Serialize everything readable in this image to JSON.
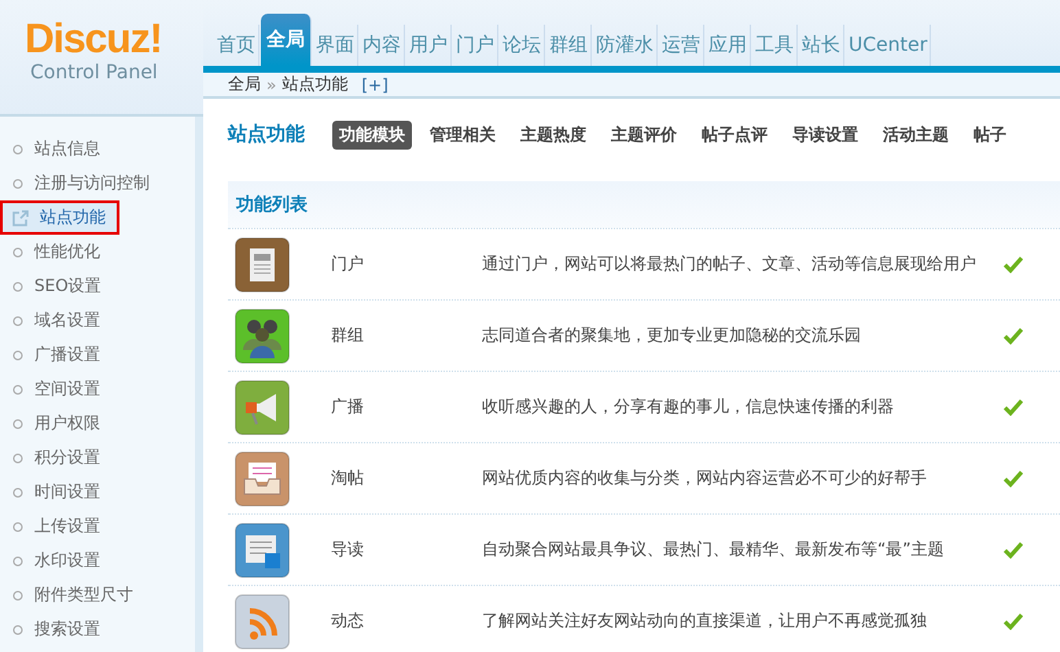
{
  "logo": {
    "title": "Discuz!",
    "subtitle": "Control Panel"
  },
  "nav": [
    {
      "label": "首页",
      "selected": false
    },
    {
      "label": "全局",
      "selected": true
    },
    {
      "label": "界面",
      "selected": false
    },
    {
      "label": "内容",
      "selected": false
    },
    {
      "label": "用户",
      "selected": false
    },
    {
      "label": "门户",
      "selected": false
    },
    {
      "label": "论坛",
      "selected": false
    },
    {
      "label": "群组",
      "selected": false
    },
    {
      "label": "防灌水",
      "selected": false
    },
    {
      "label": "运营",
      "selected": false
    },
    {
      "label": "应用",
      "selected": false
    },
    {
      "label": "工具",
      "selected": false
    },
    {
      "label": "站长",
      "selected": false
    },
    {
      "label": "UCenter",
      "selected": false
    }
  ],
  "breadcrumb": {
    "parent": "全局",
    "separator": "»",
    "current": "站点功能",
    "toggle": "[+]"
  },
  "sidebar": {
    "items": [
      {
        "label": "站点信息",
        "selected": false,
        "highlighted": false
      },
      {
        "label": "注册与访问控制",
        "selected": false,
        "highlighted": false
      },
      {
        "label": "站点功能",
        "selected": true,
        "highlighted": true
      },
      {
        "label": "性能优化",
        "selected": false,
        "highlighted": false
      },
      {
        "label": "SEO设置",
        "selected": false,
        "highlighted": false
      },
      {
        "label": "域名设置",
        "selected": false,
        "highlighted": false
      },
      {
        "label": "广播设置",
        "selected": false,
        "highlighted": false
      },
      {
        "label": "空间设置",
        "selected": false,
        "highlighted": false
      },
      {
        "label": "用户权限",
        "selected": false,
        "highlighted": false
      },
      {
        "label": "积分设置",
        "selected": false,
        "highlighted": false
      },
      {
        "label": "时间设置",
        "selected": false,
        "highlighted": false
      },
      {
        "label": "上传设置",
        "selected": false,
        "highlighted": false
      },
      {
        "label": "水印设置",
        "selected": false,
        "highlighted": false
      },
      {
        "label": "附件类型尺寸",
        "selected": false,
        "highlighted": false
      },
      {
        "label": "搜索设置",
        "selected": false,
        "highlighted": false
      }
    ]
  },
  "page_title": "站点功能",
  "subtabs": [
    {
      "label": "功能模块",
      "selected": true
    },
    {
      "label": "管理相关",
      "selected": false
    },
    {
      "label": "主题热度",
      "selected": false
    },
    {
      "label": "主题评价",
      "selected": false
    },
    {
      "label": "帖子点评",
      "selected": false
    },
    {
      "label": "导读设置",
      "selected": false
    },
    {
      "label": "活动主题",
      "selected": false
    },
    {
      "label": "帖子",
      "selected": false
    }
  ],
  "table": {
    "header": "功能列表",
    "rows": [
      {
        "kind": "newspaper",
        "name": "门户",
        "description": "通过门户，网站可以将最热门的帖子、文章、活动等信息展现给用户",
        "enabled": true
      },
      {
        "kind": "people",
        "name": "群组",
        "description": "志同道合者的聚集地，更加专业更加隐秘的交流乐园",
        "enabled": true
      },
      {
        "kind": "megaphone",
        "name": "广播",
        "description": "收听感兴趣的人，分享有趣的事儿，信息快速传播的利器",
        "enabled": true
      },
      {
        "kind": "tray",
        "name": "淘帖",
        "description": "网站优质内容的收集与分类，网站内容运营必不可少的好帮手",
        "enabled": true
      },
      {
        "kind": "document",
        "name": "导读",
        "description": "自动聚合网站最具争议、最热门、最精华、最新发布等“最”主题",
        "enabled": true
      },
      {
        "kind": "rss",
        "name": "动态",
        "description": "了解网站关注好友网站动向的直接渠道，让用户不再感觉孤独",
        "enabled": true
      }
    ]
  }
}
